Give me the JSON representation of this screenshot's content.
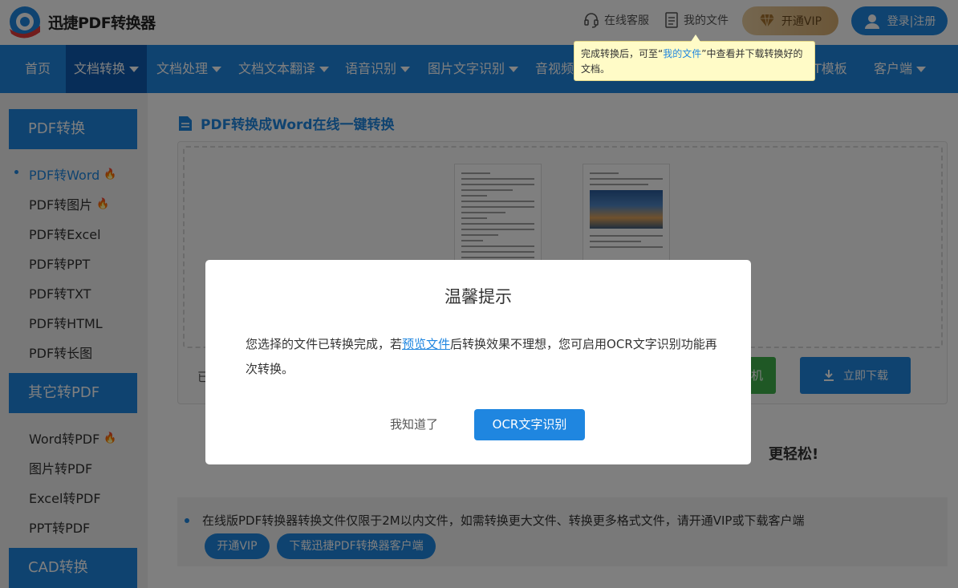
{
  "header": {
    "app_name": "迅捷PDF转换器",
    "service_label": "在线客服",
    "files_label": "我的文件",
    "vip_label": "开通VIP",
    "login_label": "登录|注册"
  },
  "tooltip": {
    "text_before": "完成转换后，可至“",
    "link": "我的文件",
    "text_after": "”中查看并下载转换好的文档。"
  },
  "nav": {
    "items": [
      "首页",
      "文档转换",
      "文档处理",
      "文档文本翻译",
      "语音识别",
      "图片文字识别",
      "音视频",
      "T模板",
      "客户端"
    ],
    "active": "文档转换"
  },
  "sidebar": {
    "sections": [
      {
        "title": "PDF转换",
        "items": [
          "PDF转Word",
          "PDF转图片",
          "PDF转Excel",
          "PDF转PPT",
          "PDF转TXT",
          "PDF转HTML",
          "PDF转长图"
        ]
      },
      {
        "title": "其它转PDF",
        "items": [
          "Word转PDF",
          "图片转PDF",
          "Excel转PDF",
          "PPT转PDF"
        ]
      },
      {
        "title": "CAD转换",
        "items": []
      }
    ]
  },
  "main": {
    "title": "PDF转换成Word在线一键转换",
    "partial_left_text": "已",
    "green_button_label": "机",
    "download_label": "立即下载",
    "slogan_partial": "更轻松!",
    "notice_text": "在线版PDF转换器转换文件仅限于2M以内文件，如需转换更大文件、转换更多格式文件，请开通VIP或下载客户端",
    "notice_vip_label": "开通VIP",
    "notice_client_label": "下载迅捷PDF转换器客户端"
  },
  "modal": {
    "title": "温馨提示",
    "body_before": "您选择的文件已转换完成，若",
    "body_link": "预览文件",
    "body_after": "后转换效果不理想，您可启用OCR文字识别功能再次转换。",
    "cancel_label": "我知道了",
    "ok_label": "OCR文字识别"
  },
  "colors": {
    "primary": "#1f86e0",
    "nav_active": "#0e5bb0",
    "vip_gold": "#d6ac70",
    "green": "#3fb04a",
    "tooltip_bg": "#fffbc7"
  }
}
